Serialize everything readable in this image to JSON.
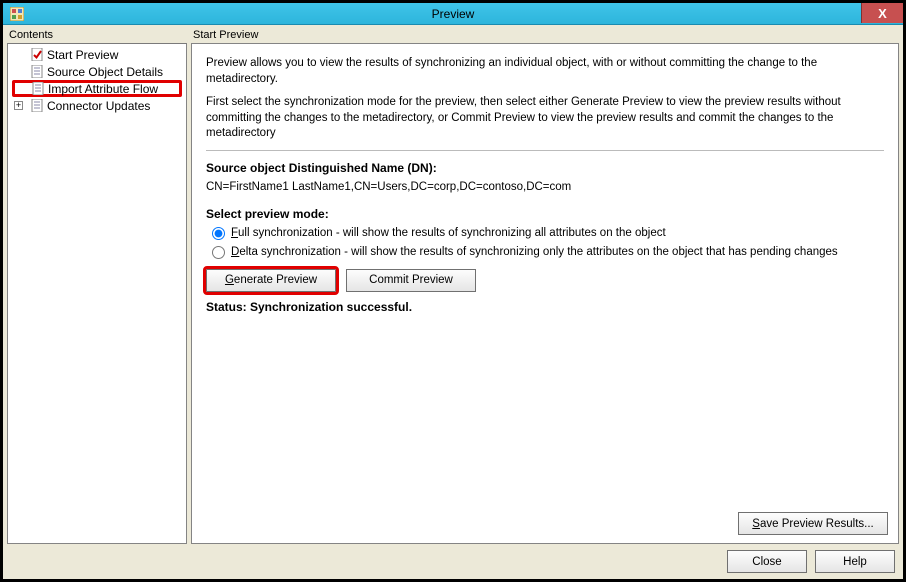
{
  "window": {
    "title": "Preview"
  },
  "sidebar": {
    "header": "Contents",
    "items": [
      {
        "label": "Start Preview",
        "icon": "check-doc",
        "expandable": false
      },
      {
        "label": "Source Object Details",
        "icon": "doc",
        "expandable": false
      },
      {
        "label": "Import Attribute Flow",
        "icon": "doc",
        "expandable": false,
        "highlight": true
      },
      {
        "label": "Connector Updates",
        "icon": "doc",
        "expandable": true
      }
    ]
  },
  "main": {
    "header": "Start Preview",
    "intro1": "Preview allows you to view the results of synchronizing an individual object, with or without committing the change to the metadirectory.",
    "intro2": "First select the synchronization mode for the preview, then select either Generate Preview to view the preview results without committing the changes to the metadirectory, or Commit Preview to view the preview results and commit the changes to the metadirectory",
    "dn_label": "Source object Distinguished Name (DN):",
    "dn_value": "CN=FirstName1 LastName1,CN=Users,DC=corp,DC=contoso,DC=com",
    "mode_label": "Select preview mode:",
    "radio_full_prefix": "F",
    "radio_full_rest": "ull synchronization - will show the results of synchronizing all attributes on the object",
    "radio_delta_prefix": "D",
    "radio_delta_rest": "elta synchronization - will show the results of synchronizing only the attributes on the object that has pending changes",
    "generate_prefix": "G",
    "generate_rest": "enerate Preview",
    "commit_label": "Commit Preview",
    "status_label": "Status: Synchronization successful.",
    "save_prefix": "S",
    "save_rest": "ave Preview Results..."
  },
  "footer": {
    "close": "Close",
    "help": "Help"
  }
}
